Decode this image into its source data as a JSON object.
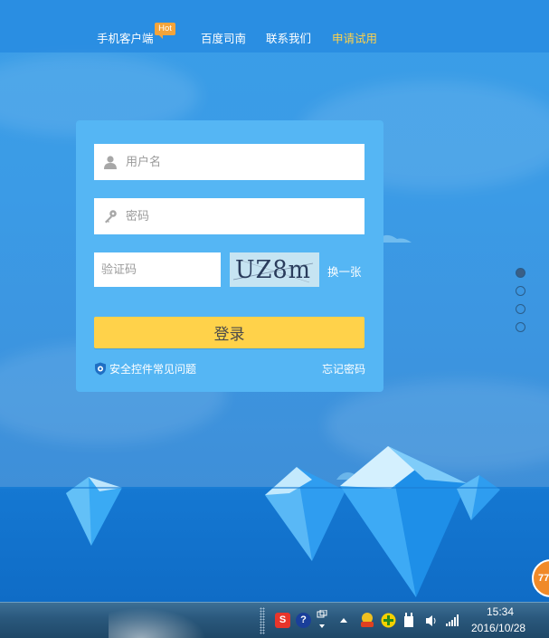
{
  "nav": {
    "items": [
      {
        "label": "手机客户端"
      },
      {
        "label": "百度司南"
      },
      {
        "label": "联系我们"
      },
      {
        "label": "申请试用"
      }
    ],
    "hot_badge": "Hot",
    "active_color": "#ffd24a"
  },
  "login": {
    "username_placeholder": "用户名",
    "password_placeholder": "密码",
    "captcha_placeholder": "验证码",
    "captcha_text": "UZ8m",
    "refresh_captcha_label": "换一张",
    "submit_label": "登录",
    "help_link": "安全控件常见问题",
    "forgot_link": "忘记密码",
    "button_color": "#ffd24a",
    "panel_color": "#55b6f4"
  },
  "carousel": {
    "dot_count": 4,
    "active_index": 0
  },
  "float_badge": {
    "text": "77"
  },
  "taskbar": {
    "tray_icons": [
      "sogou-input-icon",
      "help-icon",
      "network-notify-icon",
      "show-hidden-icons-icon",
      "security-guard-icon",
      "green-plus-icon",
      "power-plug-icon",
      "volume-icon",
      "signal-icon"
    ],
    "clock": {
      "time": "15:34",
      "date": "2016/10/28"
    }
  }
}
